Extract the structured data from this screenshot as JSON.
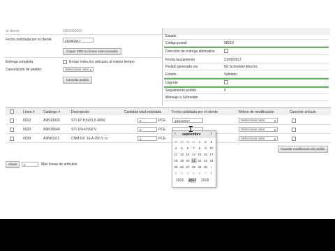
{
  "left_form": {
    "cut_top_label": "Id cliente",
    "cut_top_value": "0000000000",
    "requested_date_label": "Fecha solicitada por el cliente",
    "requested_date_value": "21/09/2017",
    "copy_date_button": "Copiar CRD en líneas seleccionadas",
    "full_delivery_label": "Entrega completa",
    "full_delivery_option": "Enviar todos los artículos al mismo tiempo",
    "order_cancel_label": "Cancelación de pedido:",
    "order_cancel_select": "Seleccionar valor",
    "cancel_order_button": "Cancelar pedido"
  },
  "right_panel": {
    "rows": [
      {
        "label": "Estado",
        "value": ""
      },
      {
        "label": "Código postal",
        "value": "08019"
      },
      {
        "label": "Dirección de entrega alternativa",
        "value": ""
      },
      {
        "label": "Fecha lanzamiento",
        "value": "21/09/2017"
      },
      {
        "label": "Pedido generado vía",
        "value": "No Schneider Electric"
      },
      {
        "label": "Estado",
        "value": "Validado"
      },
      {
        "label": "Urgente",
        "value": ""
      },
      {
        "label": "Seguimiento pedido",
        "value": "0"
      },
      {
        "label": "Mensaje a Schneider",
        "value": ""
      }
    ]
  },
  "table": {
    "headers": [
      "Línea #",
      "Catálogo #",
      "Descripción",
      "Cantidad total solicitada",
      "Fecha solicitada por el cliente",
      "Motivo de modificación",
      "Cancelar artículo"
    ],
    "rows": [
      {
        "line": "0010",
        "catalog": "A9N10033",
        "desc": "STI 1P 8,5x31,5 400V",
        "qty": "2",
        "unit": "PCE",
        "date": "16/11/2017",
        "reason": "Seleccionar valor"
      },
      {
        "line": "0020",
        "catalog": "A9N15640",
        "desc": "STI 1P+N 500 V",
        "qty": "2",
        "unit": "PCE",
        "date": "",
        "reason": "Seleccionar valor"
      },
      {
        "line": "0030",
        "catalog": "A9N61511",
        "desc": "CNM-DC 1E A 250 V cc",
        "qty": "1",
        "unit": "PCE",
        "date": "",
        "reason": "Seleccionar valor"
      }
    ],
    "save_button": "Guardar modificación de pedido",
    "add_button": "Añadir",
    "add_count": "0",
    "add_label": "Más líneas de artículos"
  },
  "calendar": {
    "prev": "‹",
    "month": "septiembre",
    "next": "›",
    "rows": [
      [
        "28",
        "29",
        "30",
        "31",
        "1",
        "2",
        "3"
      ],
      [
        "4",
        "5",
        "6",
        "7",
        "8",
        "9",
        "10"
      ],
      [
        "11",
        "12",
        "13",
        "14",
        "15",
        "16",
        "17"
      ],
      [
        "18",
        "19",
        "20",
        "21",
        "22",
        "23",
        "24"
      ],
      [
        "25",
        "26",
        "27",
        "28",
        "29",
        "30",
        "1"
      ],
      [
        "2",
        "3",
        "4",
        "5",
        "6",
        "7",
        "8"
      ]
    ],
    "years": [
      "2016",
      "2017",
      "2018"
    ]
  }
}
